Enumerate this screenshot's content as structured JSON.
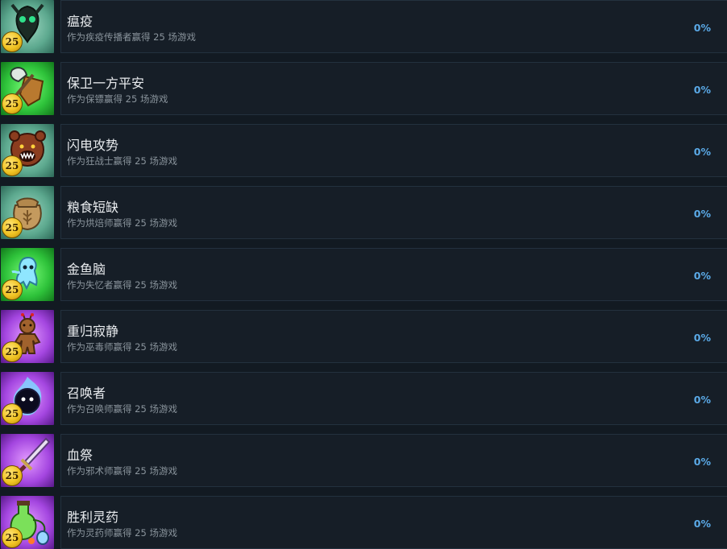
{
  "colors": {
    "background": "#121a22",
    "panel": "#161e27",
    "title": "#e8ebee",
    "description": "#8a949c",
    "percent": "#5aa9e6",
    "coin": "#f0c322"
  },
  "achievements": [
    {
      "title": "瘟疫",
      "description": "作为疾疫传播者赢得 25 场游戏",
      "percent": "0%",
      "coin": "25",
      "icon": "plague-mask-icon",
      "theme": "teal"
    },
    {
      "title": "保卫一方平安",
      "description": "作为保镖赢得 25 场游戏",
      "percent": "0%",
      "coin": "25",
      "icon": "axe-shield-icon",
      "theme": "green"
    },
    {
      "title": "闪电攻势",
      "description": "作为狂战士赢得 25 场游戏",
      "percent": "0%",
      "coin": "25",
      "icon": "bear-head-icon",
      "theme": "teal"
    },
    {
      "title": "粮食短缺",
      "description": "作为烘焙师赢得 25 场游戏",
      "percent": "0%",
      "coin": "25",
      "icon": "grain-sack-icon",
      "theme": "teal"
    },
    {
      "title": "金鱼脑",
      "description": "作为失忆者赢得 25 场游戏",
      "percent": "0%",
      "coin": "25",
      "icon": "ghost-icon",
      "theme": "green"
    },
    {
      "title": "重归寂静",
      "description": "作为巫毒师赢得 25 场游戏",
      "percent": "0%",
      "coin": "25",
      "icon": "voodoo-doll-icon",
      "theme": "purple"
    },
    {
      "title": "召唤者",
      "description": "作为召唤师赢得 25 场游戏",
      "percent": "0%",
      "coin": "25",
      "icon": "dark-orb-icon",
      "theme": "purple"
    },
    {
      "title": "血祭",
      "description": "作为邪术师赢得 25 场游戏",
      "percent": "0%",
      "coin": "25",
      "icon": "ritual-dagger-icon",
      "theme": "purple"
    },
    {
      "title": "胜利灵药",
      "description": "作为灵药师赢得 25 场游戏",
      "percent": "0%",
      "coin": "25",
      "icon": "potion-flask-icon",
      "theme": "purple"
    }
  ]
}
